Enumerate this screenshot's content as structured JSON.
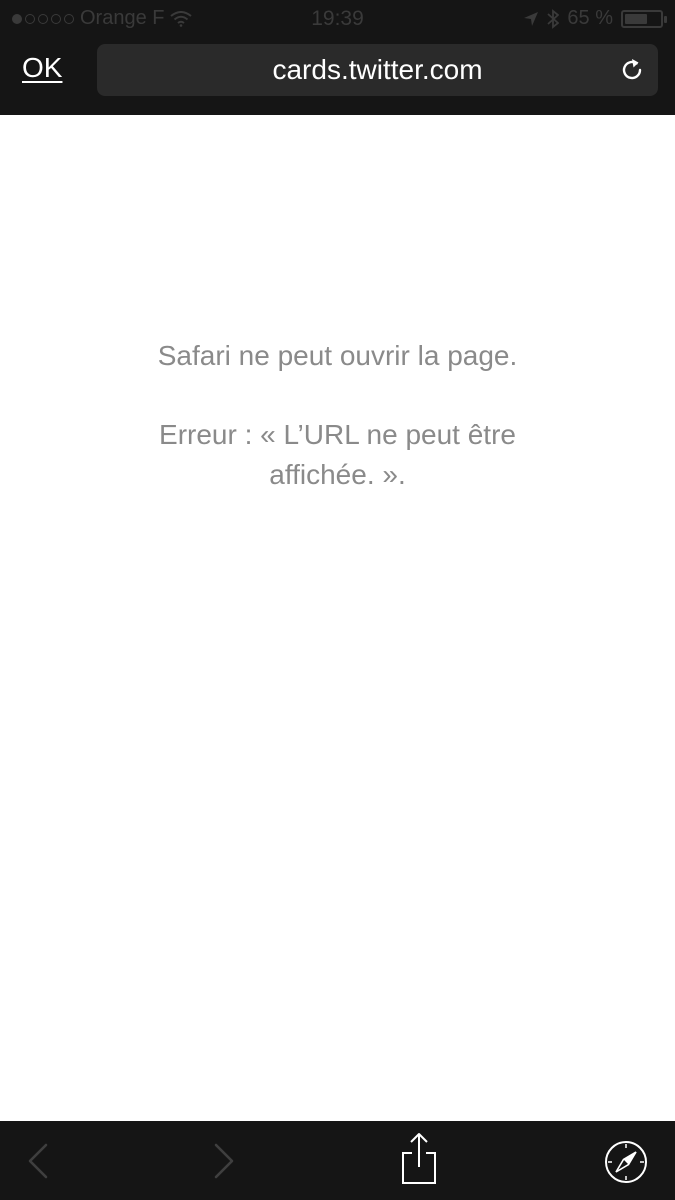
{
  "status_bar": {
    "carrier": "Orange F",
    "time": "19:39",
    "battery": "65 %",
    "battery_level": 0.65,
    "signal_bars_filled": 1,
    "signal_bars_total": 5
  },
  "nav": {
    "done_label": "OK",
    "url": "cards.twitter.com"
  },
  "content": {
    "title": "Safari ne peut ouvrir la page.",
    "error_line1": "Erreur : « L’URL ne peut être",
    "error_line2": "affichée. »."
  },
  "icons": {
    "wifi": "wifi-icon",
    "location": "location-arrow-icon",
    "bluetooth": "bluetooth-icon",
    "reload": "reload-icon",
    "back": "chevron-left-icon",
    "forward": "chevron-right-icon",
    "share": "share-icon",
    "safari": "compass-icon"
  },
  "colors": {
    "bar_background": "#151515",
    "url_field": "#2a2a2a",
    "message_text": "#8a8a8a",
    "status_text": "#3a3a3a"
  }
}
